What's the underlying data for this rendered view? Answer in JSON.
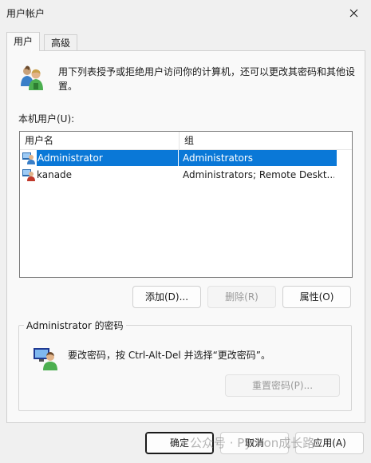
{
  "window": {
    "title": "用户帐户"
  },
  "tabs": [
    {
      "label": "用户"
    },
    {
      "label": "高级"
    }
  ],
  "intro": {
    "text": "用下列表授予或拒绝用户访问你的计算机，还可以更改其密码和其他设置。"
  },
  "users_list": {
    "label": "本机用户(U):",
    "columns": [
      "用户名",
      "组"
    ],
    "rows": [
      {
        "name": "Administrator",
        "group": "Administrators"
      },
      {
        "name": "kanade",
        "group": "Administrators; Remote Deskt..."
      }
    ]
  },
  "buttons": {
    "add": "添加(D)...",
    "remove": "删除(R)",
    "properties": "属性(O)"
  },
  "password_group": {
    "title": "Administrator 的密码",
    "text": "要改密码，按 Ctrl-Alt-Del 并选择“更改密码”。",
    "reset_button": "重置密码(P)..."
  },
  "footer": {
    "ok": "确定",
    "cancel": "取消",
    "apply": "应用(A)"
  },
  "watermark": {
    "text": "公众号 · Python成长路"
  },
  "colors": {
    "selection": "#0a78d7",
    "background": "#f0f0f0",
    "panel": "#f9f9f9"
  }
}
